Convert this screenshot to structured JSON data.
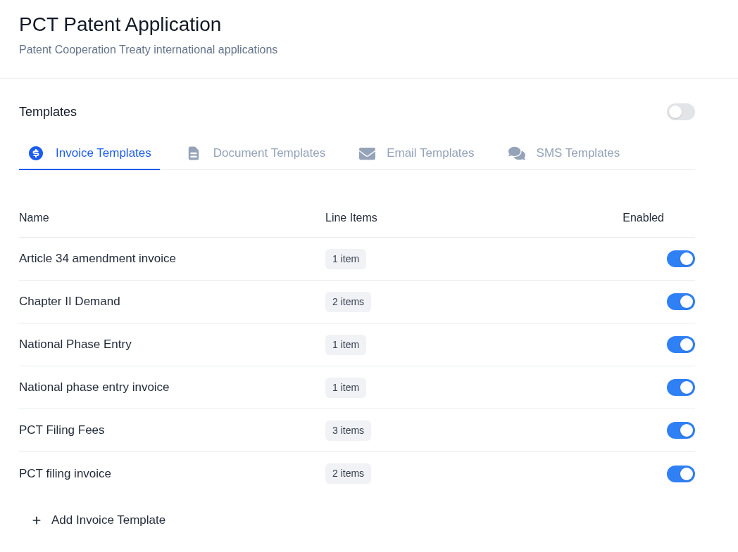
{
  "header": {
    "title": "PCT Patent Application",
    "subtitle": "Patent Cooperation Treaty international applications"
  },
  "templates": {
    "heading": "Templates",
    "enabled": false,
    "tabs": [
      {
        "kind": "invoice",
        "label": "Invoice Templates",
        "selected": true
      },
      {
        "kind": "document",
        "label": "Document Templates",
        "selected": false
      },
      {
        "kind": "email",
        "label": "Email Templates",
        "selected": false
      },
      {
        "kind": "sms",
        "label": "SMS Templates",
        "selected": false
      }
    ],
    "table": {
      "columns": [
        "Name",
        "Line Items",
        "Enabled"
      ],
      "rows": [
        {
          "name": "Article 34 amendment invoice",
          "line_items": "1 item",
          "enabled": true
        },
        {
          "name": "Chapter II Demand",
          "line_items": "2 items",
          "enabled": true
        },
        {
          "name": "National Phase Entry",
          "line_items": "1 item",
          "enabled": true
        },
        {
          "name": "National phase entry invoice",
          "line_items": "1 item",
          "enabled": true
        },
        {
          "name": "PCT Filing Fees",
          "line_items": "3 items",
          "enabled": true
        },
        {
          "name": "PCT filing invoice",
          "line_items": "2 items",
          "enabled": true
        }
      ]
    },
    "add_button": {
      "label": "Add Invoice Template"
    }
  }
}
